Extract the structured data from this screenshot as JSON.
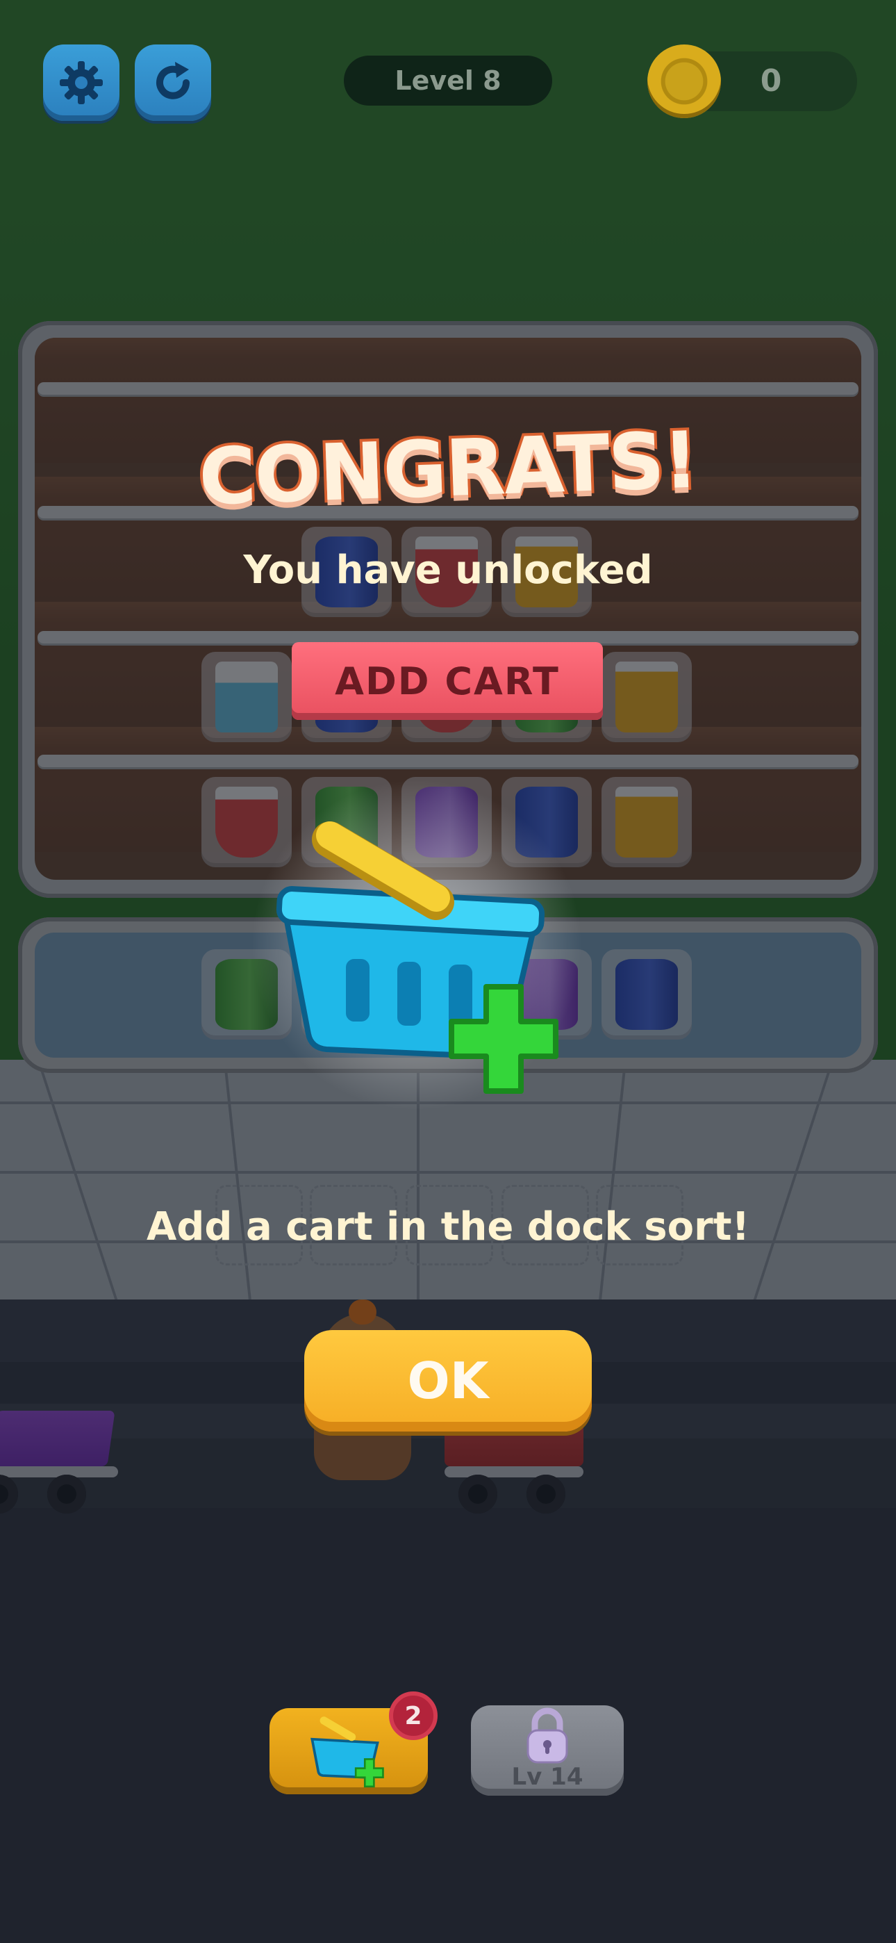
{
  "hud": {
    "level_label": "Level 8",
    "coin_count": "0"
  },
  "popup": {
    "title": "CONGRATS!",
    "subtitle": "You have unlocked",
    "feature_name": "ADD CART",
    "instruction": "Add a cart in the dock sort!",
    "ok_label": "OK"
  },
  "tools": {
    "add_cart_badge": "2",
    "locked_label": "Lv 14"
  },
  "shelf_rows": [
    [
      "can-blue",
      "cup-red",
      "cup-yellow"
    ],
    [
      "milk",
      "can-blue",
      "cup-red",
      "can-green",
      "cup-yellow"
    ],
    [
      "cup-red",
      "can-green",
      "can-purple",
      "can-blue",
      "cup-yellow"
    ]
  ],
  "dock_items": [
    "can-green",
    "",
    "",
    "can-purple",
    "can-blue"
  ],
  "colors": {
    "green_bg": "#3b8a37",
    "ok_button": "#f6ad25",
    "feature_banner": "#e8505f",
    "plus_icon": "#3ad43a",
    "basket": "#1fc2ee"
  }
}
